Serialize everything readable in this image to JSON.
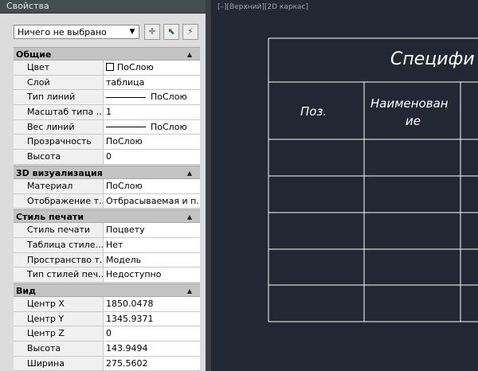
{
  "panel": {
    "title": "Свойства",
    "selector": "Ничего не выбрано",
    "buttons": [
      "toggle-pickadd",
      "select-objects",
      "quick-select"
    ]
  },
  "sections": [
    {
      "title": "Общие",
      "rows": [
        {
          "key": "Цвет",
          "value": "ПоСлою",
          "swatch": true
        },
        {
          "key": "Слой",
          "value": "таблица"
        },
        {
          "key": "Тип линий",
          "value": "ПоСлою",
          "line": true
        },
        {
          "key": "Масштаб типа ...",
          "value": "1"
        },
        {
          "key": "Вес линий",
          "value": "ПоСлою",
          "line": true
        },
        {
          "key": "Прозрачность",
          "value": "ПоСлою"
        },
        {
          "key": "Высота",
          "value": "0"
        }
      ]
    },
    {
      "title": "3D визуализация",
      "rows": [
        {
          "key": "Материал",
          "value": "ПоСлою"
        },
        {
          "key": "Отображение т...",
          "value": "Отбрасываемая и п..."
        }
      ]
    },
    {
      "title": "Стиль печати",
      "rows": [
        {
          "key": "Стиль печати",
          "value": "Поцвету"
        },
        {
          "key": "Таблица стиле...",
          "value": "Нет"
        },
        {
          "key": "Пространство т...",
          "value": "Модель"
        },
        {
          "key": "Тип стилей печ...",
          "value": "Недоступно"
        }
      ]
    },
    {
      "title": "Вид",
      "rows": [
        {
          "key": "Центр X",
          "value": "1850.0478"
        },
        {
          "key": "Центр Y",
          "value": "1345.9371"
        },
        {
          "key": "Центр Z",
          "value": "0"
        },
        {
          "key": "Высота",
          "value": "143.9494"
        },
        {
          "key": "Ширина",
          "value": "275.5602"
        }
      ]
    }
  ],
  "viewport": {
    "label": "[–][Верхний][2D каркас]",
    "table_title": "Специфи",
    "col1": "Поз.",
    "col2a": "Наименован",
    "col2b": "ие"
  },
  "colors": {
    "panel_bg": "#dcdcdc",
    "viewport_bg": "#212833",
    "drawing_lines": "#ffffff"
  }
}
